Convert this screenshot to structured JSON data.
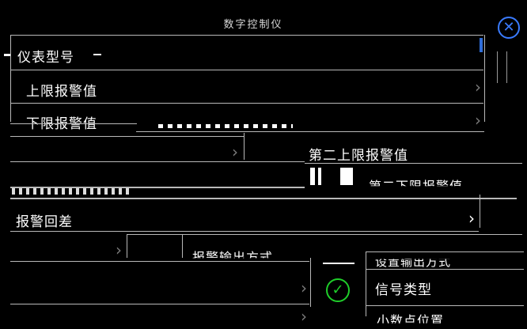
{
  "dialog": {
    "title": "数字控制仪",
    "close_icon": "close-circle-icon"
  },
  "menu_items": [
    {
      "label": "仪表型号"
    },
    {
      "label": "上限报警值"
    },
    {
      "label": "下限报警值"
    },
    {
      "label": "第二上限报警值"
    },
    {
      "label": "第二下限报警值"
    },
    {
      "label": "报警回差"
    },
    {
      "label": "报警输出方式"
    },
    {
      "label": "设置输出方式"
    },
    {
      "label": "信号类型"
    },
    {
      "label": "小数点位置"
    }
  ],
  "confirm_icon": "check-circle-icon",
  "chevron_glyph": "›",
  "colors": {
    "background": "#000000",
    "divider": "#b9b9b9",
    "close_accent": "#3a7bff",
    "confirm_accent": "#1fce2a"
  }
}
